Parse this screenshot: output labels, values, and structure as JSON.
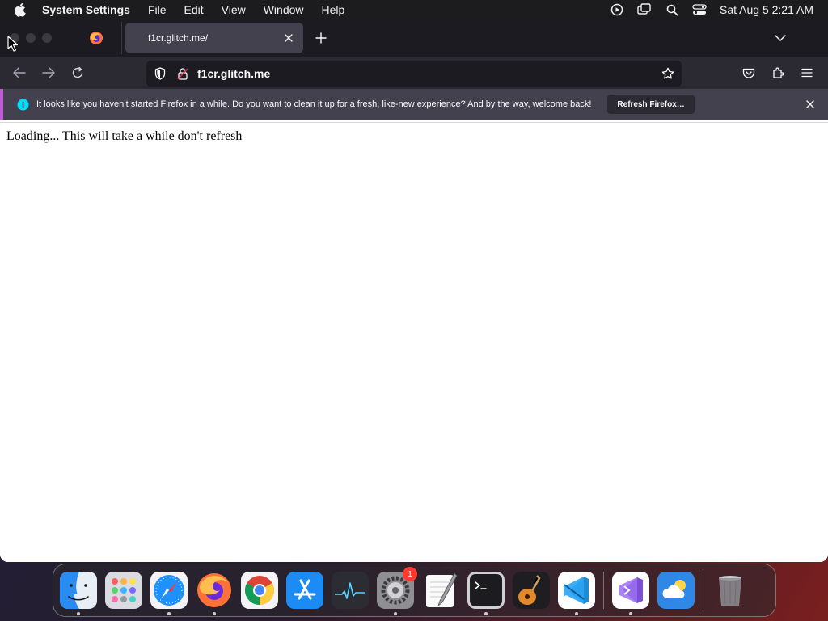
{
  "menubar": {
    "app_name": "System Settings",
    "menus": [
      "File",
      "Edit",
      "View",
      "Window",
      "Help"
    ],
    "clock": "Sat Aug 5  2:21 AM"
  },
  "browser": {
    "active_tab_title": "f1cr.glitch.me/",
    "url": "f1cr.glitch.me",
    "notification": {
      "message": "It looks like you haven’t started Firefox in a while. Do you want to clean it up for a fresh, like-new experience? And by the way, welcome back!",
      "button_label": "Refresh Firefox…"
    },
    "page_text": "Loading... This will take a while don't refresh"
  },
  "dock": {
    "settings_badge": "1",
    "apps": [
      "finder",
      "launchpad",
      "safari",
      "firefox",
      "chrome",
      "app-store",
      "activity-monitor",
      "system-settings",
      "textedit",
      "terminal",
      "garageband",
      "vscode",
      "visual-studio",
      "weather",
      "trash"
    ]
  },
  "colors": {
    "tabstrip": "#1c1b22",
    "navbar": "#2b2a33",
    "notification": "#42414d",
    "accent": "#c05bd6"
  }
}
